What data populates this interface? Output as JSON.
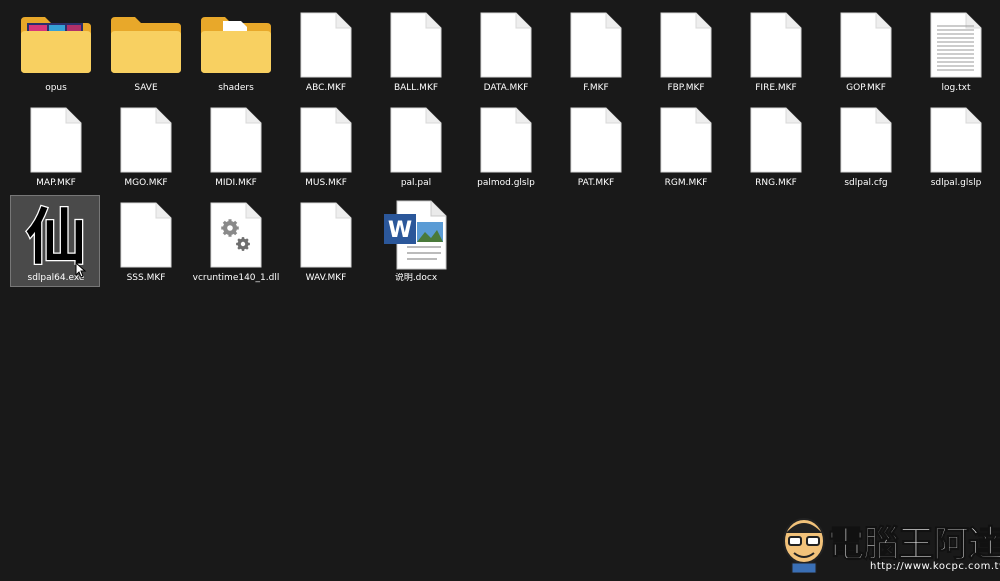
{
  "window": {
    "background": "#191919"
  },
  "items": [
    {
      "name": "opus",
      "kind": "folder-media",
      "icon": "folder-icon"
    },
    {
      "name": "SAVE",
      "kind": "folder",
      "icon": "folder-icon"
    },
    {
      "name": "shaders",
      "kind": "folder-doc",
      "icon": "folder-icon"
    },
    {
      "name": "ABC.MKF",
      "kind": "file",
      "icon": "file-icon"
    },
    {
      "name": "BALL.MKF",
      "kind": "file",
      "icon": "file-icon"
    },
    {
      "name": "DATA.MKF",
      "kind": "file",
      "icon": "file-icon"
    },
    {
      "name": "F.MKF",
      "kind": "file",
      "icon": "file-icon"
    },
    {
      "name": "FBP.MKF",
      "kind": "file",
      "icon": "file-icon"
    },
    {
      "name": "FIRE.MKF",
      "kind": "file",
      "icon": "file-icon"
    },
    {
      "name": "GOP.MKF",
      "kind": "file",
      "icon": "file-icon"
    },
    {
      "name": "log.txt",
      "kind": "text",
      "icon": "text-file-icon"
    },
    {
      "name": "MAP.MKF",
      "kind": "file",
      "icon": "file-icon"
    },
    {
      "name": "MGO.MKF",
      "kind": "file",
      "icon": "file-icon"
    },
    {
      "name": "MIDI.MKF",
      "kind": "file",
      "icon": "file-icon"
    },
    {
      "name": "MUS.MKF",
      "kind": "file",
      "icon": "file-icon"
    },
    {
      "name": "pal.pal",
      "kind": "file",
      "icon": "file-icon"
    },
    {
      "name": "palmod.glslp",
      "kind": "file",
      "icon": "file-icon"
    },
    {
      "name": "PAT.MKF",
      "kind": "file",
      "icon": "file-icon"
    },
    {
      "name": "RGM.MKF",
      "kind": "file",
      "icon": "file-icon"
    },
    {
      "name": "RNG.MKF",
      "kind": "file",
      "icon": "file-icon"
    },
    {
      "name": "sdlpal.cfg",
      "kind": "file",
      "icon": "file-icon"
    },
    {
      "name": "sdlpal.glslp",
      "kind": "file",
      "icon": "file-icon"
    },
    {
      "name": "sdlpal64.exe",
      "kind": "exe",
      "icon": "xian-character-icon",
      "selected": true,
      "glyph": "仙"
    },
    {
      "name": "SSS.MKF",
      "kind": "file",
      "icon": "file-icon"
    },
    {
      "name": "vcruntime140_1.dll",
      "kind": "dll",
      "icon": "gears-file-icon"
    },
    {
      "name": "WAV.MKF",
      "kind": "file",
      "icon": "file-icon"
    },
    {
      "name": "说明.docx",
      "kind": "docx",
      "icon": "word-document-icon",
      "glyph": "W"
    }
  ],
  "watermark": {
    "text": "電腦王阿達",
    "url": "http://www.kocpc.com.tw"
  }
}
